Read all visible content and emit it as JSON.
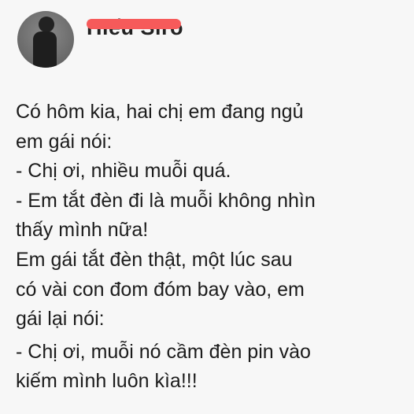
{
  "author": {
    "name": "Hiếu Siro",
    "avatar_icon": "user-avatar"
  },
  "post": {
    "lines": [
      "Có hôm kia, hai chị em đang ngủ",
      "em gái nói:",
      "- Chị ơi, nhiều muỗi quá.",
      "- Em tắt đèn đi là muỗi không nhìn",
      "thấy mình nữa!",
      "Em gái tắt đèn thật, một lúc sau",
      "có vài con đom đóm bay vào, em",
      "gái lại nói:",
      "- Chị ơi, muỗi nó cầm đèn pin vào",
      "kiếm mình luôn kìa!!!"
    ]
  },
  "colors": {
    "redaction": "#f65a5a",
    "background": "#f7f7f7"
  }
}
